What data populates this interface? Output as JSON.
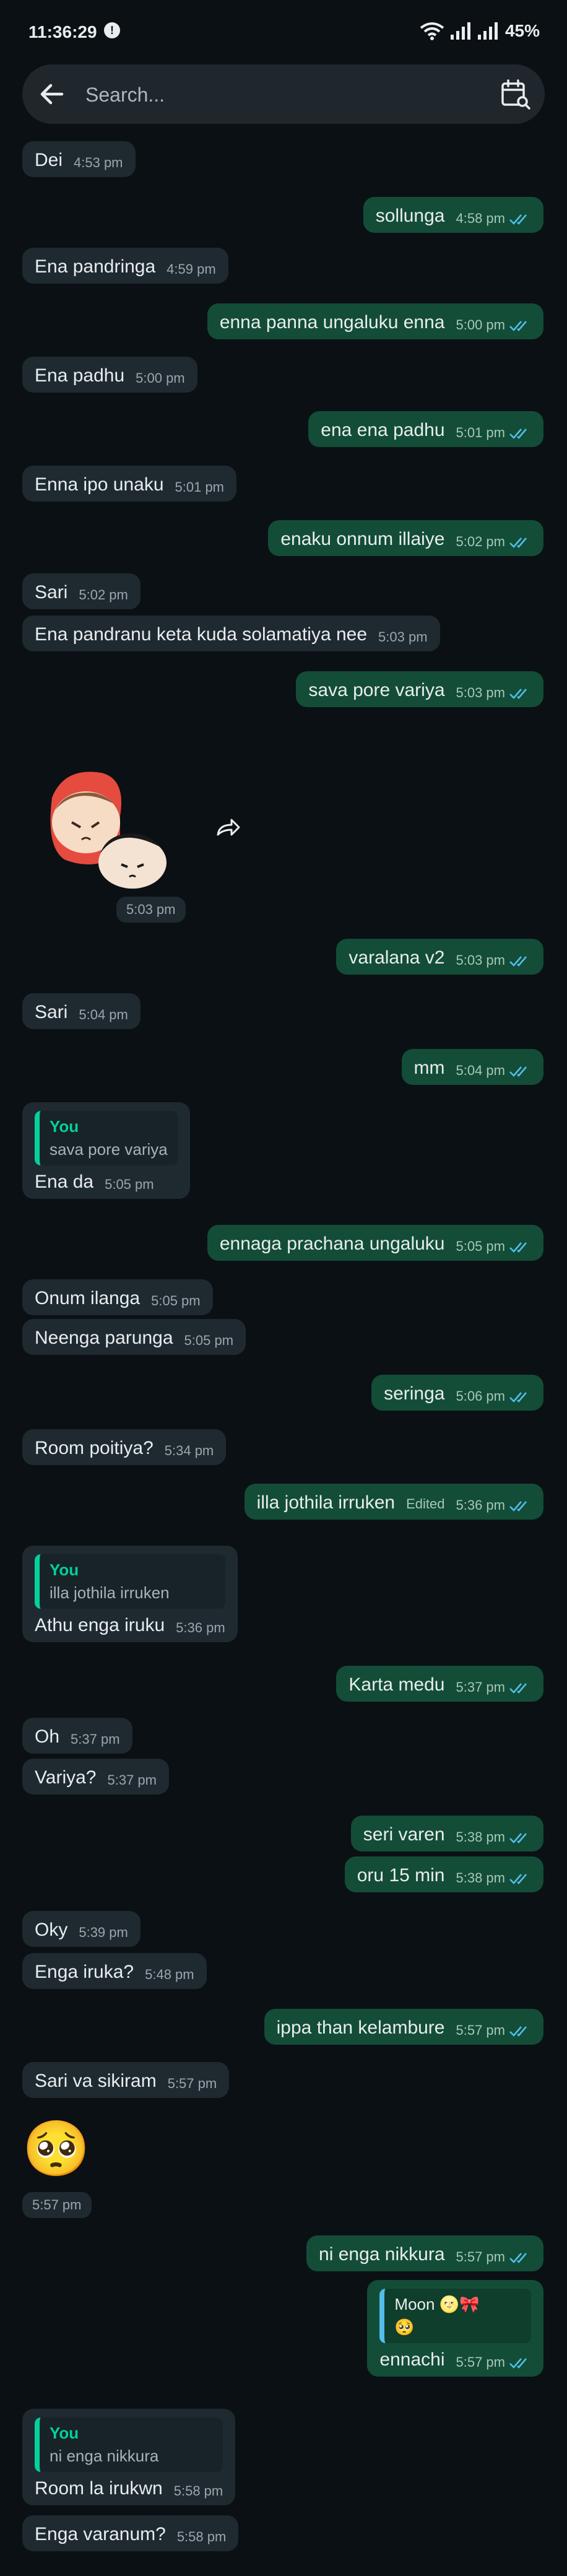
{
  "status_bar": {
    "time": "11:36:29",
    "battery": "45%"
  },
  "search": {
    "placeholder": "Search..."
  },
  "messages": [
    {
      "dir": "in",
      "text": "Dei",
      "time": "4:53 pm"
    },
    {
      "dir": "out",
      "text": "sollunga",
      "time": "4:58 pm"
    },
    {
      "dir": "in",
      "text": "Ena pandringa",
      "time": "4:59 pm"
    },
    {
      "dir": "out",
      "text": "enna panna ungaluku enna",
      "time": "5:00 pm"
    },
    {
      "dir": "in",
      "text": "Ena padhu",
      "time": "5:00 pm"
    },
    {
      "dir": "out",
      "text": "ena ena padhu",
      "time": "5:01 pm"
    },
    {
      "dir": "in",
      "text": "Enna ipo unaku",
      "time": "5:01 pm"
    },
    {
      "dir": "out",
      "text": "enaku onnum illaiye",
      "time": "5:02 pm"
    },
    {
      "dir": "in",
      "text": "Sari",
      "time": "5:02 pm"
    },
    {
      "dir": "in",
      "text": "Ena pandranu keta kuda solamatiya nee",
      "time": "5:03 pm"
    },
    {
      "dir": "out",
      "text": "sava pore variya",
      "time": "5:03 pm"
    },
    {
      "dir": "in",
      "type": "sticker",
      "time": "5:03 pm"
    },
    {
      "dir": "out",
      "text": "varalana v2",
      "time": "5:03 pm"
    },
    {
      "dir": "in",
      "text": "Sari",
      "time": "5:04 pm"
    },
    {
      "dir": "out",
      "text": "mm",
      "time": "5:04 pm"
    },
    {
      "dir": "in",
      "quote_name": "You",
      "quote_text": "sava pore variya",
      "text": "Ena da",
      "time": "5:05 pm"
    },
    {
      "dir": "out",
      "text": "ennaga prachana ungaluku",
      "time": "5:05 pm"
    },
    {
      "dir": "in",
      "text": "Onum ilanga",
      "time": "5:05 pm"
    },
    {
      "dir": "in",
      "text": "Neenga parunga",
      "time": "5:05 pm"
    },
    {
      "dir": "out",
      "text": "seringa",
      "time": "5:06 pm"
    },
    {
      "dir": "in",
      "text": "Room poitiya?",
      "time": "5:34 pm"
    },
    {
      "dir": "out",
      "text": "illa jothila irruken",
      "edited": "Edited",
      "time": "5:36 pm"
    },
    {
      "dir": "in",
      "quote_name": "You",
      "quote_text": "illa jothila irruken",
      "text": "Athu enga iruku",
      "time": "5:36 pm"
    },
    {
      "dir": "out",
      "text": "Karta medu",
      "time": "5:37 pm"
    },
    {
      "dir": "in",
      "text": "Oh",
      "time": "5:37 pm"
    },
    {
      "dir": "in",
      "text": "Variya?",
      "time": "5:37 pm"
    },
    {
      "dir": "out",
      "text": "seri varen",
      "time": "5:38 pm"
    },
    {
      "dir": "out",
      "text": "oru 15 min",
      "time": "5:38 pm"
    },
    {
      "dir": "in",
      "text": "Oky",
      "time": "5:39 pm"
    },
    {
      "dir": "in",
      "text": "Enga iruka?",
      "time": "5:48 pm"
    },
    {
      "dir": "out",
      "text": "ippa than kelambure",
      "time": "5:57 pm"
    },
    {
      "dir": "in",
      "text": "Sari va sikiram",
      "time": "5:57 pm"
    },
    {
      "dir": "in",
      "type": "emoji",
      "emoji": "🥺",
      "time": "5:57 pm"
    },
    {
      "dir": "out",
      "text": "ni enga nikkura",
      "time": "5:57 pm"
    },
    {
      "dir": "out",
      "quote_name": "Moon 🌝🎀",
      "quote_text": "🥺",
      "text": "ennachi",
      "time": "5:57 pm"
    },
    {
      "dir": "in",
      "quote_name": "You",
      "quote_text": "ni enga nikkura",
      "text": "Room la irukwn",
      "time": "5:58 pm"
    },
    {
      "dir": "in",
      "text": "Enga varanum?",
      "time": "5:58 pm"
    }
  ]
}
